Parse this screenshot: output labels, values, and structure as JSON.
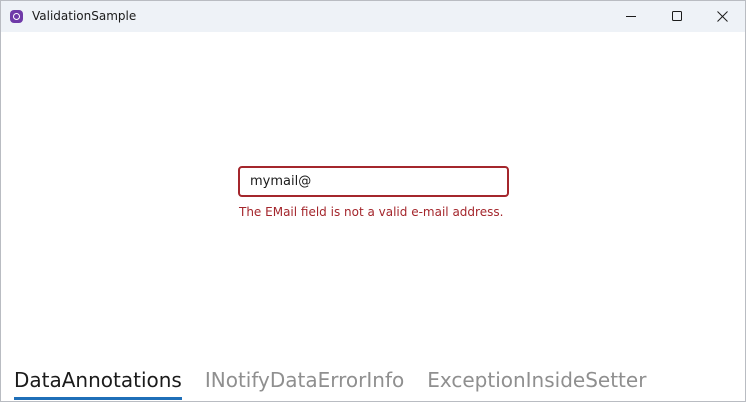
{
  "window": {
    "title": "ValidationSample",
    "icon": "app-logo-icon",
    "buttons": [
      "minimize-icon",
      "maximize-icon",
      "close-icon"
    ]
  },
  "form": {
    "email_value": "mymail@",
    "error_message": "The EMail field is not a valid e-mail address."
  },
  "tabs": [
    {
      "label": "DataAnnotations",
      "active": true
    },
    {
      "label": "INotifyDataErrorInfo",
      "active": false
    },
    {
      "label": "ExceptionInsideSetter",
      "active": false
    }
  ],
  "colors": {
    "error": "#a4262c",
    "accent": "#1f6fb8",
    "titlebar": "#eef2f7"
  }
}
